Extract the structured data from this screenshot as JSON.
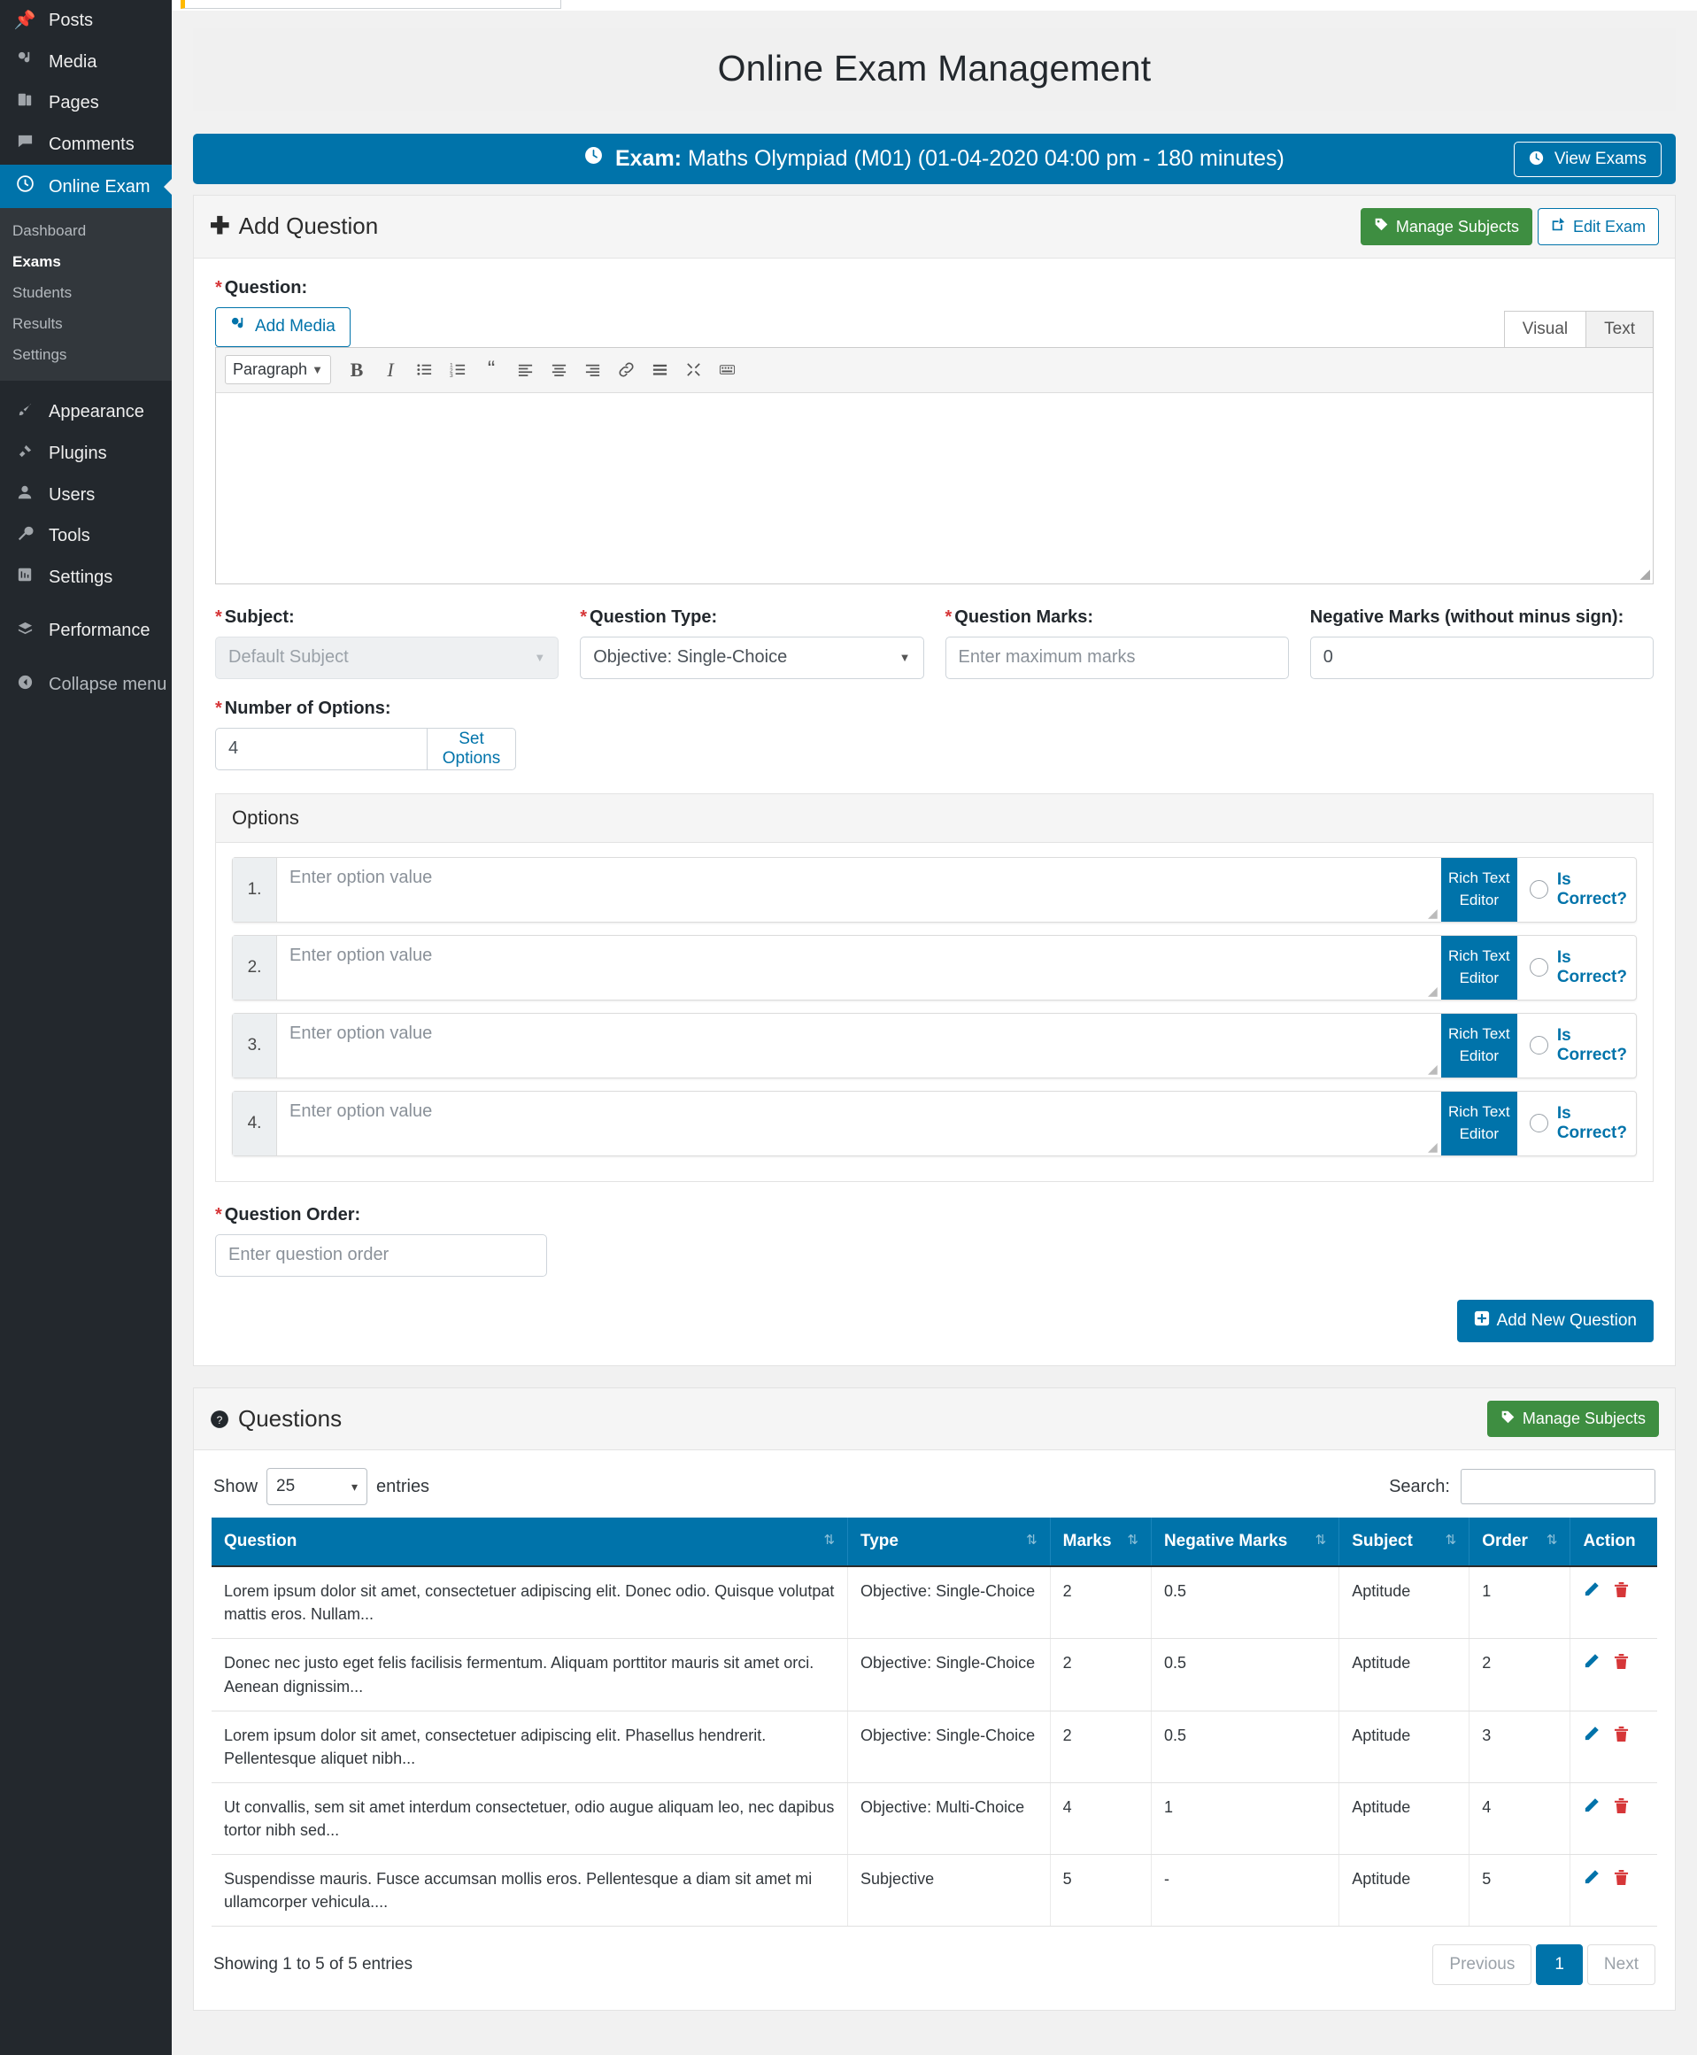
{
  "sidebar": {
    "items": [
      {
        "label": "Posts",
        "icon": "pin-icon"
      },
      {
        "label": "Media",
        "icon": "media-icon"
      },
      {
        "label": "Pages",
        "icon": "pages-icon"
      },
      {
        "label": "Comments",
        "icon": "comments-icon"
      },
      {
        "label": "Online Exam",
        "icon": "clock-icon",
        "current": true
      }
    ],
    "submenu": [
      {
        "label": "Dashboard"
      },
      {
        "label": "Exams",
        "active": true
      },
      {
        "label": "Students"
      },
      {
        "label": "Results"
      },
      {
        "label": "Settings"
      }
    ],
    "items2": [
      {
        "label": "Appearance",
        "icon": "brush-icon"
      },
      {
        "label": "Plugins",
        "icon": "plug-icon"
      },
      {
        "label": "Users",
        "icon": "user-icon"
      },
      {
        "label": "Tools",
        "icon": "wrench-icon"
      },
      {
        "label": "Settings",
        "icon": "settings-icon"
      }
    ],
    "items3": [
      {
        "label": "Performance",
        "icon": "performance-icon"
      }
    ],
    "collapse": {
      "label": "Collapse menu",
      "icon": "collapse-icon"
    }
  },
  "page": {
    "title": "Online Exam Management"
  },
  "exam_bar": {
    "clock_icon": "clock-icon",
    "prefix": "Exam:",
    "detail": " Maths Olympiad (M01) (01-04-2020 04:00 pm - 180 minutes)",
    "view_exams_label": "View Exams"
  },
  "add_question": {
    "heading": "Add Question",
    "plus_icon": "plus-icon",
    "manage_subjects_label": "Manage Subjects",
    "edit_exam_label": "Edit Exam",
    "question_label": "Question:",
    "add_media_label": "Add Media",
    "tab_visual": "Visual",
    "tab_text": "Text",
    "paragraph_select": "Paragraph",
    "toolbar_icons": [
      "bold-icon",
      "italic-icon",
      "bulleted-list-icon",
      "numbered-list-icon",
      "blockquote-icon",
      "align-left-icon",
      "align-center-icon",
      "align-right-icon",
      "link-icon",
      "insert-more-icon",
      "fullscreen-icon",
      "toolbar-toggle-icon"
    ],
    "subject_label": "Subject:",
    "subject_value": "Default Subject",
    "question_type_label": "Question Type:",
    "question_type_value": "Objective: Single-Choice",
    "question_marks_label": "Question Marks:",
    "question_marks_placeholder": "Enter maximum marks",
    "negative_marks_label": "Negative Marks (without minus sign):",
    "negative_marks_value": "0",
    "number_of_options_label": "Number of Options:",
    "number_of_options_value": "4",
    "set_options_label": "Set Options",
    "options_title": "Options",
    "option_placeholder": "Enter option value",
    "rich_text_editor_label": "Rich Text Editor",
    "is_correct_label": "Is Correct?",
    "options": [
      {
        "num": "1."
      },
      {
        "num": "2."
      },
      {
        "num": "3."
      },
      {
        "num": "4."
      }
    ],
    "question_order_label": "Question Order:",
    "question_order_placeholder": "Enter question order",
    "add_new_question_label": "Add New Question"
  },
  "questions_panel": {
    "heading": "Questions",
    "help_icon": "question-circle-icon",
    "manage_subjects_label": "Manage Subjects",
    "show_label": "Show",
    "entries_label": "entries",
    "entries_value": "25",
    "search_label": "Search:",
    "search_value": "",
    "columns": [
      {
        "label": "Question",
        "sortable": true
      },
      {
        "label": "Type",
        "sortable": true
      },
      {
        "label": "Marks",
        "sortable": true
      },
      {
        "label": "Negative Marks",
        "sortable": true
      },
      {
        "label": "Subject",
        "sortable": true
      },
      {
        "label": "Order",
        "sortable": true
      },
      {
        "label": "Action",
        "sortable": false
      }
    ],
    "rows": [
      {
        "question": "Lorem ipsum dolor sit amet, consectetuer adipiscing elit. Donec odio. Quisque volutpat mattis eros. Nullam...",
        "type": "Objective: Single-Choice",
        "marks": "2",
        "negative_marks": "0.5",
        "subject": "Aptitude",
        "order": "1"
      },
      {
        "question": "Donec nec justo eget felis facilisis fermentum. Aliquam porttitor mauris sit amet orci. Aenean dignissim...",
        "type": "Objective: Single-Choice",
        "marks": "2",
        "negative_marks": "0.5",
        "subject": "Aptitude",
        "order": "2"
      },
      {
        "question": "Lorem ipsum dolor sit amet, consectetuer adipiscing elit. Phasellus hendrerit. Pellentesque aliquet nibh...",
        "type": "Objective: Single-Choice",
        "marks": "2",
        "negative_marks": "0.5",
        "subject": "Aptitude",
        "order": "3"
      },
      {
        "question": "Ut convallis, sem sit amet interdum consectetuer, odio augue aliquam leo, nec dapibus tortor nibh sed...",
        "type": "Objective: Multi-Choice",
        "marks": "4",
        "negative_marks": "1",
        "subject": "Aptitude",
        "order": "4"
      },
      {
        "question": "Suspendisse mauris. Fusce accumsan mollis eros. Pellentesque a diam sit amet mi ullamcorper vehicula....",
        "type": "Subjective",
        "marks": "5",
        "negative_marks": "-",
        "subject": "Aptitude",
        "order": "5"
      }
    ],
    "info": "Showing 1 to 5 of 5 entries",
    "previous_label": "Previous",
    "page_label": "1",
    "next_label": "Next",
    "edit_icon": "pencil-icon",
    "delete_icon": "trash-icon"
  },
  "colors": {
    "accent": "#0073aa",
    "green": "#3e8e41",
    "danger": "#d63638",
    "sidebar": "#23282d"
  }
}
